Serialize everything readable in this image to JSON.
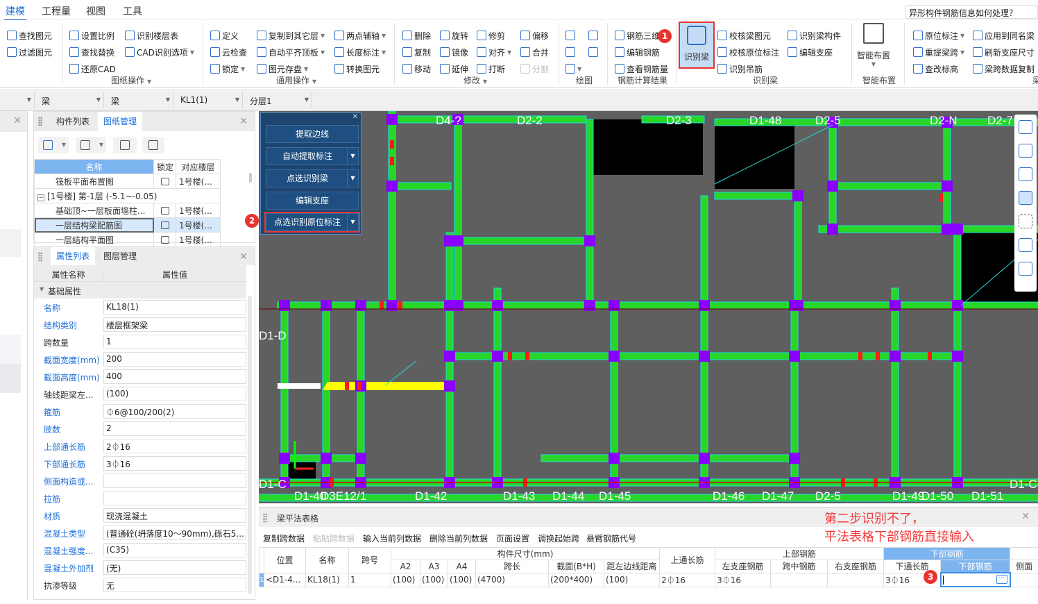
{
  "menu": {
    "tabs": [
      "建模",
      "工程量",
      "视图",
      "工具"
    ],
    "active": 0
  },
  "help_search": "异形构件钢筋信息如何处理？",
  "ribbon": {
    "groups": [
      {
        "label": "图纸操作",
        "items": [
          {
            "label": "查找图元",
            "icon": "find-element"
          },
          {
            "label": "过滤图元",
            "icon": "filter"
          },
          {
            "label": "设置比例",
            "icon": "set-scale"
          },
          {
            "label": "查找替换",
            "icon": "find-replace"
          },
          {
            "label": "还原CAD",
            "icon": "restore-cad"
          },
          {
            "label": "识别楼层表",
            "icon": "floor-table"
          },
          {
            "label": "CAD识别选项",
            "icon": "cad-options",
            "dropdown": true
          }
        ]
      },
      {
        "label": "通用操作",
        "items": [
          {
            "label": "定义",
            "icon": "define"
          },
          {
            "label": "云检查",
            "icon": "cloud-check"
          },
          {
            "label": "锁定",
            "icon": "lock",
            "dropdown": true
          },
          {
            "label": "复制到其它层",
            "icon": "copy-layer",
            "dropdown": true
          },
          {
            "label": "自动平齐顶板",
            "icon": "align-top",
            "dropdown": true
          },
          {
            "label": "图元存盘",
            "icon": "save-element",
            "dropdown": true
          },
          {
            "label": "两点辅轴",
            "icon": "axis",
            "dropdown": true
          },
          {
            "label": "长度标注",
            "icon": "dimension",
            "dropdown": true
          },
          {
            "label": "转换图元",
            "icon": "convert"
          }
        ]
      },
      {
        "label": "修改",
        "items": [
          {
            "label": "删除",
            "icon": "delete"
          },
          {
            "label": "复制",
            "icon": "copy"
          },
          {
            "label": "移动",
            "icon": "move"
          },
          {
            "label": "旋转",
            "icon": "rotate"
          },
          {
            "label": "镜像",
            "icon": "mirror"
          },
          {
            "label": "延伸",
            "icon": "extend"
          },
          {
            "label": "修剪",
            "icon": "trim"
          },
          {
            "label": "对齐",
            "icon": "align",
            "dropdown": true
          },
          {
            "label": "打断",
            "icon": "break"
          },
          {
            "label": "偏移",
            "icon": "offset"
          },
          {
            "label": "合并",
            "icon": "merge"
          },
          {
            "label": "分割",
            "icon": "split",
            "disabled": true
          }
        ]
      },
      {
        "label": "绘图",
        "items": [
          {
            "label": "",
            "icon": "point"
          },
          {
            "label": "",
            "icon": "circle"
          },
          {
            "label": "",
            "icon": "line"
          },
          {
            "label": "",
            "icon": "rectangle"
          },
          {
            "label": "",
            "icon": "arc",
            "dropdown": true
          }
        ]
      },
      {
        "label": "钢筋计算结果",
        "items": [
          {
            "label": "钢筋三维",
            "icon": "rebar-3d"
          },
          {
            "label": "编辑钢筋",
            "icon": "edit-rebar"
          },
          {
            "label": "查看钢筋量",
            "icon": "view-rebar"
          }
        ]
      },
      {
        "label": "识别梁",
        "big": {
          "label": "识别梁",
          "icon": "identify-beam",
          "highlighted": true
        },
        "items": [
          {
            "label": "校核梁图元",
            "icon": "check-beam"
          },
          {
            "label": "校核原位标注",
            "icon": "check-annotation"
          },
          {
            "label": "识别吊筋",
            "icon": "hanger-rebar"
          },
          {
            "label": "识别梁构件",
            "icon": "beam-component"
          },
          {
            "label": "编辑支座",
            "icon": "edit-support"
          }
        ]
      },
      {
        "label": "智能布置",
        "big": {
          "label": "智能布置",
          "icon": "smart-layout",
          "dropdown": true
        },
        "items": []
      },
      {
        "label": "梁",
        "items": [
          {
            "label": "原位标注",
            "icon": "in-situ",
            "dropdown": true
          },
          {
            "label": "重提梁跨",
            "icon": "respan",
            "dropdown": true
          },
          {
            "label": "查改标高",
            "icon": "elevation"
          },
          {
            "label": "应用到同名梁",
            "icon": "apply-same",
            "dropdown": false
          },
          {
            "label": "刷新支座尺寸",
            "icon": "refresh-support"
          },
          {
            "label": "梁跨数据复制",
            "icon": "copy-span"
          }
        ]
      }
    ]
  },
  "selectors": [
    "",
    "梁",
    "梁",
    "KL1(1)",
    "分层1"
  ],
  "drawing_panel": {
    "tabs": [
      "构件列表",
      "图纸管理"
    ],
    "active": 1,
    "columns": [
      "名称",
      "锁定",
      "对应楼层"
    ],
    "rows": [
      {
        "name": "筏板平面布置图",
        "locked": true,
        "floor": "1号楼(..."
      },
      {
        "group": "[1号楼] 第-1层 (-5.1~-0.05)"
      },
      {
        "name": "基础顶~一层板面墙柱...",
        "locked": true,
        "floor": "1号楼(..."
      },
      {
        "name": "一层结构梁配筋图",
        "locked": true,
        "floor": "1号楼(...",
        "selected": true
      },
      {
        "name": "一层结构平面图",
        "locked": true,
        "floor": "1号楼(..."
      }
    ]
  },
  "property_panel": {
    "tabs": [
      "属性列表",
      "图层管理"
    ],
    "active": 0,
    "columns": [
      "属性名称",
      "属性值"
    ],
    "section": "基础属性",
    "rows": [
      {
        "name": "名称",
        "value": "KL18(1)",
        "blue": true
      },
      {
        "name": "结构类别",
        "value": "楼层框架梁",
        "blue": true
      },
      {
        "name": "跨数量",
        "value": "1",
        "blue": false
      },
      {
        "name": "截面宽度(mm)",
        "value": "200",
        "blue": true
      },
      {
        "name": "截面高度(mm)",
        "value": "400",
        "blue": true
      },
      {
        "name": "轴线距梁左...",
        "value": "(100)",
        "blue": false
      },
      {
        "name": "箍筋",
        "value": "⏀6@100/200(2)",
        "blue": true
      },
      {
        "name": "肢数",
        "value": "2",
        "blue": true
      },
      {
        "name": "上部通长筋",
        "value": "2⏀16",
        "blue": true
      },
      {
        "name": "下部通长筋",
        "value": "3⏀16",
        "blue": true
      },
      {
        "name": "侧面构造或...",
        "value": "",
        "blue": true
      },
      {
        "name": "拉筋",
        "value": "",
        "blue": true
      },
      {
        "name": "材质",
        "value": "现浇混凝土",
        "blue": true
      },
      {
        "name": "混凝土类型",
        "value": "(普通砼(坍落度10～90mm),砾石5...",
        "blue": true
      },
      {
        "name": "混凝土强度...",
        "value": "(C35)",
        "blue": true
      },
      {
        "name": "混凝土外加剂",
        "value": "(无)",
        "blue": true
      },
      {
        "name": "抗渗等级",
        "value": "无",
        "blue": false
      }
    ]
  },
  "float_panel": {
    "buttons": [
      {
        "label": "提取边线",
        "dropdown": false
      },
      {
        "label": "自动提取标注",
        "dropdown": true
      },
      {
        "label": "点选识别梁",
        "dropdown": true
      },
      {
        "label": "编辑支座",
        "dropdown": false
      },
      {
        "label": "点选识别原位标注",
        "dropdown": true,
        "highlighted": true
      }
    ]
  },
  "badges": [
    "1",
    "2",
    "3"
  ],
  "canvas": {
    "axis_top": [
      "D4-?",
      "D2-2",
      "D2-3",
      "D1-48",
      "D2-5",
      "D2-N",
      "D2-7"
    ],
    "axis_bottom": [
      "D1-40",
      "D3E12/1",
      "D1-42",
      "D1-43",
      "D1-44",
      "D1-45",
      "D1-46",
      "D1-47",
      "D2-5",
      "D1-49",
      "D1-50",
      "D1-51"
    ],
    "axis_left": [
      "D1-D",
      "D1-C"
    ],
    "axis_right": [
      "D1-C"
    ],
    "colors": {
      "background": "#5f5f5f",
      "beam": "#27d627",
      "beam_edge": "#1ee0e0",
      "column": "#8a00ff",
      "selected_beam": "#ffff00",
      "rebar_mark": "#ff1a1a"
    },
    "right_tools": [
      "orbit",
      "3d-view",
      "box-view",
      "solid-view",
      "zoom-extent",
      "fit-view",
      "layer-list"
    ]
  },
  "bottom_panel": {
    "title": "梁平法表格",
    "annotation": [
      "第二步识别不了，",
      "平法表格下部钢筋直接输入"
    ],
    "toolbar": [
      {
        "label": "复制跨数据"
      },
      {
        "label": "粘贴跨数据",
        "disabled": true
      },
      {
        "label": "输入当前列数据"
      },
      {
        "label": "删除当前列数据"
      },
      {
        "label": "页面设置"
      },
      {
        "label": "调换起始跨"
      },
      {
        "label": "悬臂钢筋代号"
      }
    ],
    "header_groups": {
      "size": "构件尺寸(mm)",
      "top_rebar": "上部钢筋",
      "bottom_rebar": "下部钢筋"
    },
    "columns": [
      "位置",
      "名称",
      "跨号",
      "A2",
      "A3",
      "A4",
      "跨长",
      "截面(B*H)",
      "距左边线距离",
      "上通长筋",
      "左支座钢筋",
      "跨中钢筋",
      "右支座钢筋",
      "下通长筋",
      "下部钢筋",
      "侧面"
    ],
    "rows": [
      {
        "num": "1",
        "cells": [
          "<D1-4...",
          "KL18(1)",
          "1",
          "(100)",
          "(100)",
          "(100)",
          "(4700)",
          "(200*400)",
          "(100)",
          "2⏀16",
          "3⏀16",
          "",
          "",
          "3⏀16",
          "",
          ""
        ]
      }
    ]
  }
}
